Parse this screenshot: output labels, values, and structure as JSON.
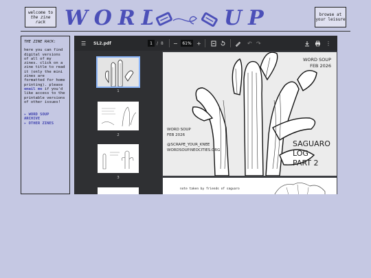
{
  "header": {
    "welcome": [
      "welcome to",
      "the zine rack"
    ],
    "logo": "WORD SOUP",
    "browse": [
      "browse at",
      "your leisure"
    ]
  },
  "sidebar": {
    "title": "THE ZINE RACK:",
    "desc_before_email": "here you can find digital versions of all of my zines. click on a zine title to read it (only the mini zines are formatted for home printing). please",
    "email_link": "email me",
    "desc_after_email": "if you'd like access to the printable versions of other issues!",
    "links": [
      "▸ WORD SOUP ARCHIVE",
      "▸ OTHER ZINES"
    ]
  },
  "pdf_viewer": {
    "filename": "SL2.pdf",
    "current_page": "1",
    "page_separator": "/",
    "total_pages": "8",
    "zoom": "61%",
    "zoom_out": "−",
    "zoom_in": "+",
    "thumbnails": [
      "1",
      "2",
      "3"
    ],
    "page1": {
      "top_right": [
        "WORD SOUP",
        "FEB 2026"
      ],
      "bottom_left_1": [
        "WORD SOUP",
        "FEB 2026"
      ],
      "bottom_left_2": [
        "@SCRAPE_YOUR_KNEE",
        "WORDSOUP.NEOCITIES.ORG"
      ],
      "bottom_right": [
        "SAGUARO",
        "LOG",
        "PART 2"
      ]
    },
    "page2_text": "note taken by friends of saguaro"
  },
  "icons": [
    "menu-icon",
    "fit-page-icon",
    "rotate-icon",
    "draw-icon",
    "undo-icon",
    "redo-icon",
    "download-icon",
    "print-icon",
    "more-icon"
  ]
}
